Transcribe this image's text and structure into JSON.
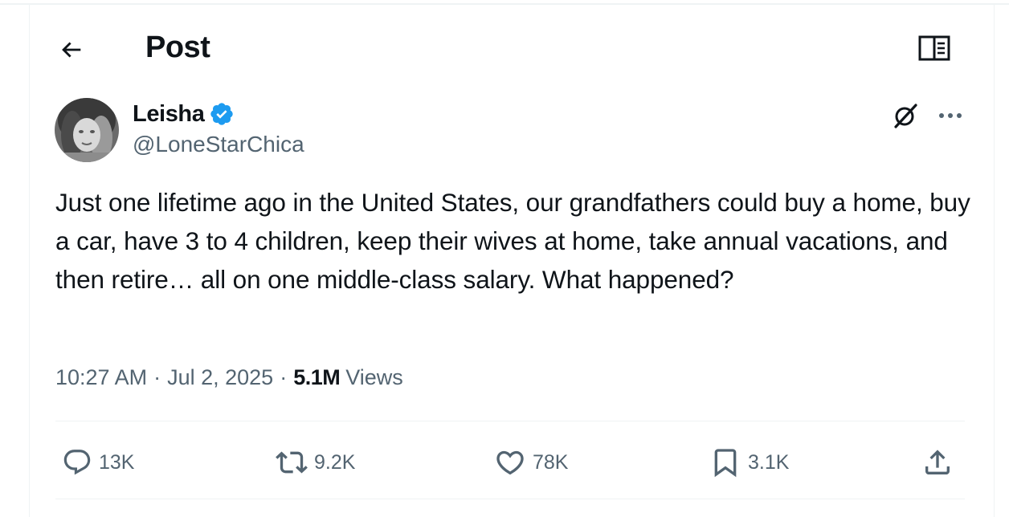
{
  "header": {
    "title": "Post",
    "back_icon": "arrow-left-icon",
    "reader_icon": "reader-mode-icon"
  },
  "author": {
    "name": "Leisha",
    "handle": "@LoneStarChica",
    "verified": true,
    "badge_color": "#1d9bf0"
  },
  "post": {
    "text": "Just one lifetime ago in the United States, our grandfathers could buy a home, buy a car, have 3 to 4 children, keep their wives at home, take annual vacations, and then retire… all on one middle-class salary. What happened?",
    "time": "10:27 AM",
    "date": "Jul 2, 2025",
    "separator": "·",
    "views_count": "5.1M",
    "views_label": "Views"
  },
  "actions": {
    "replies": "13K",
    "reposts": "9.2K",
    "likes": "78K",
    "bookmarks": "3.1K"
  },
  "colors": {
    "text_primary": "#0f1419",
    "text_secondary": "#536471",
    "border": "#eff3f4",
    "accent": "#1d9bf0"
  }
}
